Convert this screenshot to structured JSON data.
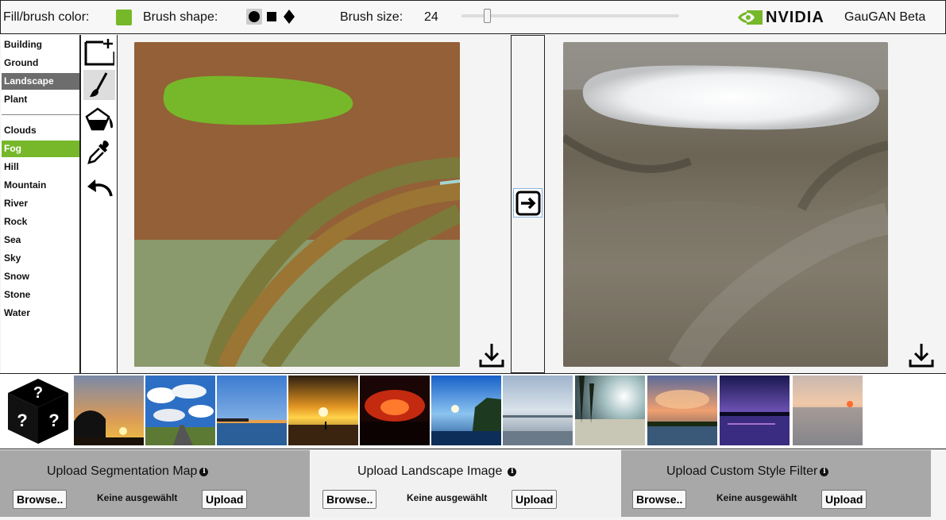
{
  "toolbar": {
    "fill_color_label": "Fill/brush color:",
    "fill_color": "#76b82a",
    "brush_shape_label": "Brush shape:",
    "brush_shapes": [
      "circle",
      "square",
      "diamond"
    ],
    "brush_shape_selected": "circle",
    "brush_size_label": "Brush size:",
    "brush_size": "24",
    "brush_size_slider_fraction": 0.12,
    "brand": "NVIDIA",
    "app_name": "GauGAN Beta"
  },
  "labels": {
    "group1": [
      {
        "label": "Building",
        "state": "normal"
      },
      {
        "label": "Ground",
        "state": "normal"
      },
      {
        "label": "Landscape",
        "state": "selected-category"
      },
      {
        "label": "Plant",
        "state": "normal"
      }
    ],
    "group2": [
      {
        "label": "Clouds",
        "state": "normal"
      },
      {
        "label": "Fog",
        "state": "selected"
      },
      {
        "label": "Hill",
        "state": "normal"
      },
      {
        "label": "Mountain",
        "state": "normal"
      },
      {
        "label": "River",
        "state": "normal"
      },
      {
        "label": "Rock",
        "state": "normal"
      },
      {
        "label": "Sea",
        "state": "normal"
      },
      {
        "label": "Sky",
        "state": "normal"
      },
      {
        "label": "Snow",
        "state": "normal"
      },
      {
        "label": "Stone",
        "state": "normal"
      },
      {
        "label": "Water",
        "state": "normal"
      }
    ]
  },
  "tools": [
    "new-canvas-icon",
    "brush-icon",
    "paint-bucket-icon",
    "eyedropper-icon",
    "undo-icon"
  ],
  "canvas_colors": {
    "sky": "#936037",
    "ground": "#8a9a6c",
    "fog": "#76b82a",
    "hill": "#7b7a3a",
    "river": "#9b7533"
  },
  "presets": {
    "count": 11,
    "dice_icon": "random-dice-icon"
  },
  "uploads": [
    {
      "title": "Upload Segmentation Map",
      "browse": "Browse..",
      "no_file": "Keine ausgewählt",
      "upload": "Upload"
    },
    {
      "title": "Upload Landscape Image",
      "browse": "Browse..",
      "no_file": "Keine ausgewählt",
      "upload": "Upload"
    },
    {
      "title": "Upload Custom Style Filter",
      "browse": "Browse..",
      "no_file": "Keine ausgewählt",
      "upload": "Upload"
    }
  ]
}
